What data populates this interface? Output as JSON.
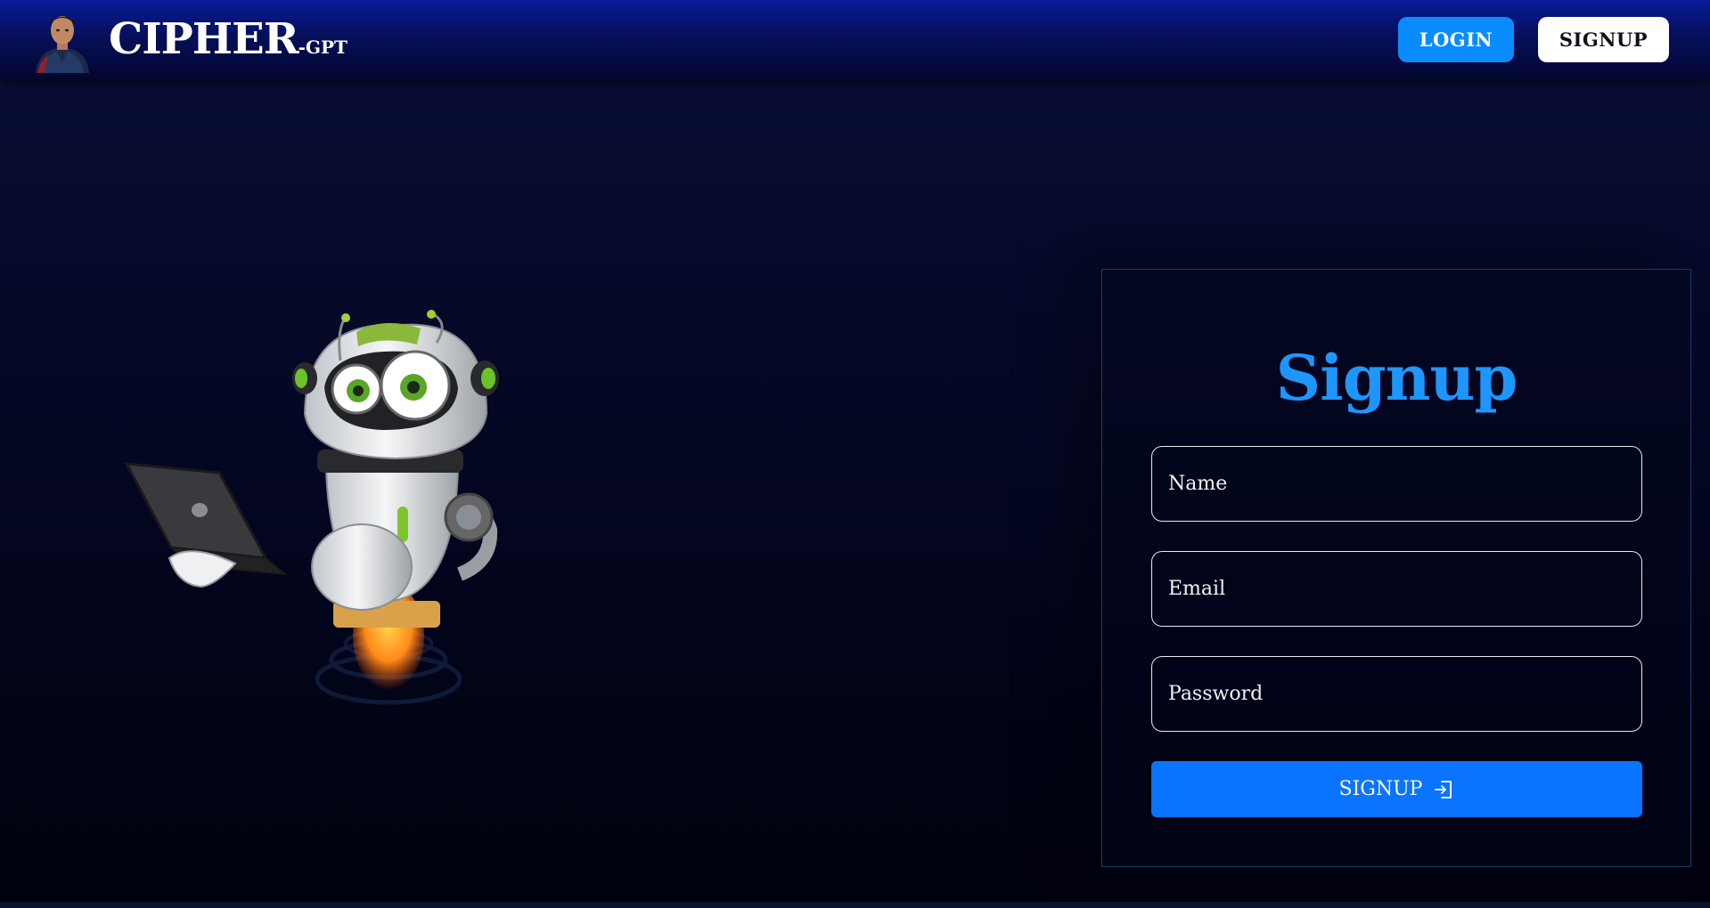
{
  "navbar": {
    "brand_name": "CIPHER",
    "brand_suffix": "-GPT",
    "login_label": "LOGIN",
    "signup_label": "SIGNUP"
  },
  "form": {
    "title": "Signup",
    "name_placeholder": "Name",
    "email_placeholder": "Email",
    "password_placeholder": "Password",
    "submit_label": "SIGNUP",
    "submit_icon": "login-arrow-icon"
  },
  "colors": {
    "accent": "#0b74ff",
    "title": "#1e96ff",
    "login_button": "#0a8cff",
    "panel_border": "#0f3e6e"
  }
}
